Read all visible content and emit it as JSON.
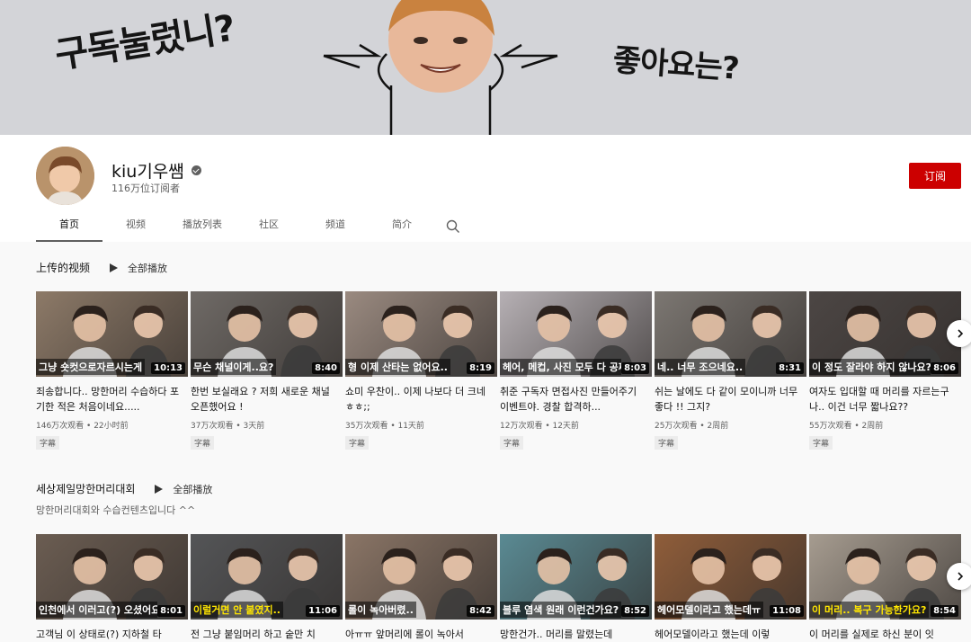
{
  "banner": {
    "left_text": "구독눌렀니?",
    "right_text": "좋아요는?"
  },
  "channel": {
    "name": "kiu기우쌤",
    "subscribers": "116万位订阅者",
    "subscribe_label": "订阅"
  },
  "tabs": [
    {
      "label": "首页"
    },
    {
      "label": "视频"
    },
    {
      "label": "播放列表"
    },
    {
      "label": "社区"
    },
    {
      "label": "频道"
    },
    {
      "label": "简介"
    }
  ],
  "sections": [
    {
      "title": "上传的视频",
      "play_all": "全部播放",
      "videos": [
        {
          "caption": "그냥 숏컷으로자르시는게",
          "duration": "10:13",
          "title": "죄송합니다.. 망한머리 수습하다 포기한 적은 처음이네요.....",
          "meta": "146万次观看 • 22小时前",
          "badge": "字幕",
          "bg": "#8d7a68"
        },
        {
          "caption": "무슨 채널이게..요?",
          "duration": "8:40",
          "title": "한번 보실래요 ? 저희 새로운 채널 오픈했어요 !",
          "meta": "37万次观看 • 3天前",
          "badge": "字幕",
          "bg": "#6f6a66"
        },
        {
          "caption": "형 이제 산타는 없어요..",
          "duration": "8:19",
          "title": "쇼미 우찬이.. 이제 나보다 더 크네 ㅎㅎ;;",
          "meta": "35万次观看 • 11天前",
          "badge": "字幕",
          "bg": "#9a8a80"
        },
        {
          "caption": "헤어, 메컵, 사진 모두 다 공짜이옵니까..?",
          "duration": "8:03",
          "title": "취준 구독자 면접사진 만들어주기 이벤트야. 경찰 합격하...",
          "meta": "12万次观看 • 12天前",
          "badge": "字幕",
          "bg": "#b6b0b4"
        },
        {
          "caption": "네.. 너무 조으네요..",
          "duration": "8:31",
          "title": "쉬는 날에도 다 같이 모이니까 너무 좋다 !! 그지?",
          "meta": "25万次观看 • 2周前",
          "badge": "字幕",
          "bg": "#7c7772"
        },
        {
          "caption": "이 정도 잘라야 하지 않나요?",
          "duration": "8:06",
          "title": "여자도 입대할 때 머리를 자르는구나.. 이건 너무 짧나요??",
          "meta": "55万次观看 • 2周前",
          "badge": "字幕",
          "bg": "#4c4644"
        }
      ]
    },
    {
      "title": "세상제일망한머리대회",
      "play_all": "全部播放",
      "subtitle": "망한머리대회와 수습컨텐츠입니다 ^^",
      "videos": [
        {
          "caption": "인천에서 이러고(?) 오셨어요..?",
          "duration": "8:01",
          "title": "고객님 이 상태로(?) 지하철 타",
          "bg": "#6b5d52"
        },
        {
          "caption": "이럴거면 안 붙였지..",
          "duration": "11:06",
          "title": "전 그냥 붙임머리 하고 숱만 치",
          "bg": "#545557"
        },
        {
          "caption": "롤이 녹아버렸..",
          "duration": "8:42",
          "title": "아ㅠㅠ 앞머리에 롤이 녹아서",
          "bg": "#8a7566"
        },
        {
          "caption": "블루 염색 원래 이런건가요?",
          "duration": "8:52",
          "title": "망한건가.. 머리를 말렸는데",
          "bg": "#5a8a93"
        },
        {
          "caption": "헤어모델이라고 했는데ㅠ",
          "duration": "11:08",
          "title": "헤어모델이라고 했는데 이렇",
          "bg": "#8f5d3a"
        },
        {
          "caption": "이 머리.. 복구 가능한가요?",
          "duration": "8:54",
          "title": "이 머리를 실제로 하신 분이 잇",
          "bg": "#a69c90"
        }
      ]
    }
  ],
  "colors": {
    "subscribe": "#cc0000",
    "banner": "#d3d4d8"
  }
}
